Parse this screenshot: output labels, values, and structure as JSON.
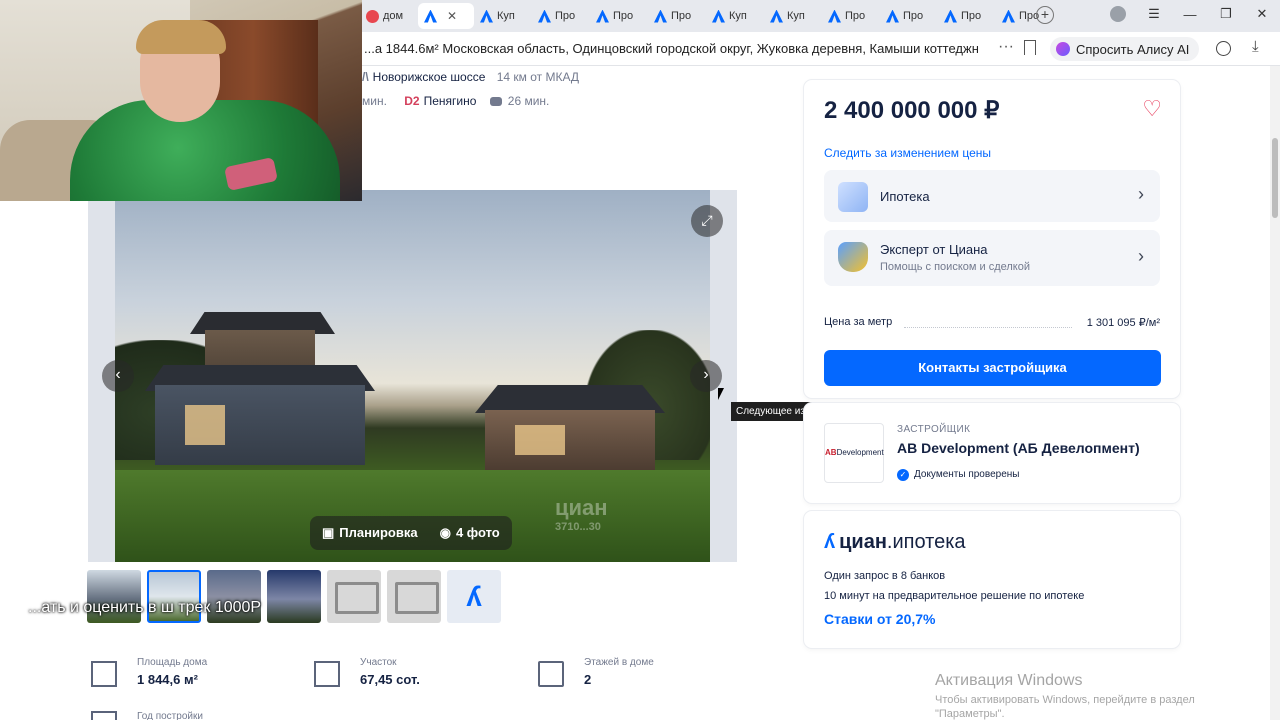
{
  "browser": {
    "tabs": [
      {
        "label": "дом",
        "active": false
      },
      {
        "label": "",
        "active": true
      },
      {
        "label": "Куп",
        "active": false
      },
      {
        "label": "Про",
        "active": false
      },
      {
        "label": "Про",
        "active": false
      },
      {
        "label": "Про",
        "active": false
      },
      {
        "label": "Куп",
        "active": false
      },
      {
        "label": "Куп",
        "active": false
      },
      {
        "label": "Про",
        "active": false
      },
      {
        "label": "Про",
        "active": false
      },
      {
        "label": "Про",
        "active": false
      },
      {
        "label": "Про",
        "active": false
      }
    ],
    "url": "...а 1844.6м² Московская область, Одинцовский городской округ, Жуковка деревня, Камыши коттеджны...",
    "alice_label": "Спросить Алису AI"
  },
  "route": {
    "highway": "Новорижское шоссе",
    "distance": "14 км от МКАД",
    "minutes_left": "мин.",
    "station_prefix": "D2",
    "station": "Пенягино",
    "drive_time": "26 мин."
  },
  "gallery": {
    "plan_label": "Планировка",
    "photos_label": "4 фото",
    "watermark": "циан",
    "watermark_id": "3710...30",
    "tooltip": "Следующее изображение"
  },
  "subtitle_overlay": "...ать и оценить в ш трек 1000Р",
  "facts": {
    "house_area_label": "Площадь дома",
    "house_area_value": "1 844,6 м²",
    "plot_label": "Участок",
    "plot_value": "67,45 сот.",
    "floors_label": "Этажей в доме",
    "floors_value": "2",
    "year_label": "Год постройки"
  },
  "price_card": {
    "price": "2 400 000 000 ₽",
    "track_link": "Следить за изменением цены",
    "mortgage_label": "Ипотека",
    "expert_title": "Эксперт от Циана",
    "expert_sub": "Помощь с поиском и сделкой",
    "per_meter_label": "Цена за метр",
    "per_meter_value": "1 301 095 ₽/м²",
    "contact_button": "Контакты застройщика"
  },
  "developer": {
    "label": "ЗАСТРОЙЩИК",
    "logo_ab": "AB",
    "logo_text": "Development",
    "name": "AB Development (АБ Девелопмент)",
    "verified": "Документы проверены"
  },
  "mortgage_promo": {
    "logo_main": "циан",
    "logo_suffix": ".ипотека",
    "line1": "Один запрос в 8 банков",
    "line2": "10 минут на предварительное решение по ипотеке",
    "rates": "Ставки от 20,7%"
  },
  "activation": {
    "title": "Активация Windows",
    "sub1": "Чтобы активировать Windows, перейдите в раздел",
    "sub2": "\"Параметры\"."
  },
  "colors": {
    "accent": "#0468ff",
    "text": "#152242",
    "muted": "#737a8e",
    "heart": "#e84260"
  }
}
